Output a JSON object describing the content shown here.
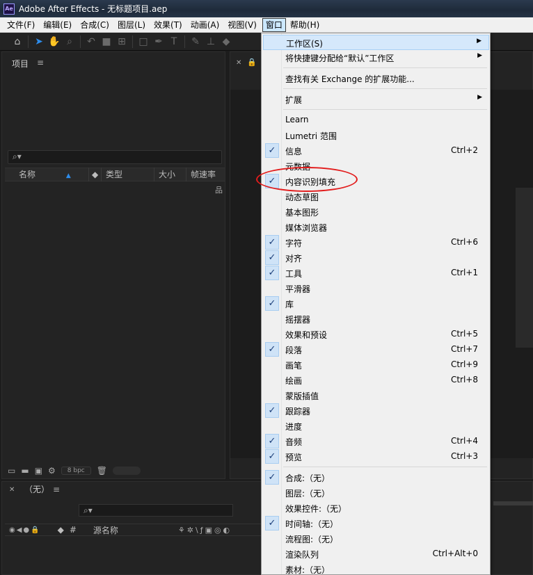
{
  "window": {
    "logo_text": "Ae",
    "title": "Adobe After Effects - 无标题项目.aep"
  },
  "menubar": [
    {
      "label": "文件(F)",
      "active": false
    },
    {
      "label": "编辑(E)",
      "active": false
    },
    {
      "label": "合成(C)",
      "active": false
    },
    {
      "label": "图层(L)",
      "active": false
    },
    {
      "label": "效果(T)",
      "active": false
    },
    {
      "label": "动画(A)",
      "active": false
    },
    {
      "label": "视图(V)",
      "active": false
    },
    {
      "label": "窗口",
      "active": true
    },
    {
      "label": "帮助(H)",
      "active": false
    }
  ],
  "project_panel": {
    "title": "项目",
    "menu_glyph": "≡",
    "search_glyph": "⌕▾",
    "columns": {
      "name": "名称",
      "type": "类型",
      "size": "大小",
      "rate": "帧速率"
    },
    "bpc": "8 bpc"
  },
  "timeline_panel": {
    "title": "（无）",
    "menu_glyph": "≡",
    "column_name": "源名称",
    "column_hash": "#"
  },
  "window_menu": {
    "items": [
      {
        "label": "工作区(S)",
        "submenu": true,
        "checked": false,
        "shortcut": "",
        "highlight": true
      },
      {
        "label": "将快捷键分配给“默认”工作区",
        "submenu": true,
        "checked": false,
        "shortcut": ""
      },
      {
        "separator": true
      },
      {
        "label": "查找有关 Exchange 的扩展功能...",
        "checked": false,
        "shortcut": ""
      },
      {
        "separator": true
      },
      {
        "label": "扩展",
        "submenu": true,
        "checked": false,
        "shortcut": ""
      },
      {
        "separator": true
      },
      {
        "label": "Learn",
        "checked": false,
        "shortcut": ""
      },
      {
        "label": "Lumetri 范围",
        "checked": false,
        "shortcut": ""
      },
      {
        "label": "信息",
        "checked": true,
        "shortcut": "Ctrl+2"
      },
      {
        "label": "元数据",
        "checked": false,
        "shortcut": ""
      },
      {
        "label": "内容识别填充",
        "checked": true,
        "shortcut": ""
      },
      {
        "label": "动态草图",
        "checked": false,
        "shortcut": ""
      },
      {
        "label": "基本图形",
        "checked": false,
        "shortcut": ""
      },
      {
        "label": "媒体浏览器",
        "checked": false,
        "shortcut": ""
      },
      {
        "label": "字符",
        "checked": true,
        "shortcut": "Ctrl+6"
      },
      {
        "label": "对齐",
        "checked": true,
        "shortcut": ""
      },
      {
        "label": "工具",
        "checked": true,
        "shortcut": "Ctrl+1"
      },
      {
        "label": "平滑器",
        "checked": false,
        "shortcut": ""
      },
      {
        "label": "库",
        "checked": true,
        "shortcut": ""
      },
      {
        "label": "摇摆器",
        "checked": false,
        "shortcut": ""
      },
      {
        "label": "效果和预设",
        "checked": false,
        "shortcut": "Ctrl+5"
      },
      {
        "label": "段落",
        "checked": true,
        "shortcut": "Ctrl+7"
      },
      {
        "label": "画笔",
        "checked": false,
        "shortcut": "Ctrl+9"
      },
      {
        "label": "绘画",
        "checked": false,
        "shortcut": "Ctrl+8"
      },
      {
        "label": "蒙版插值",
        "checked": false,
        "shortcut": ""
      },
      {
        "label": "跟踪器",
        "checked": true,
        "shortcut": ""
      },
      {
        "label": "进度",
        "checked": false,
        "shortcut": ""
      },
      {
        "label": "音频",
        "checked": true,
        "shortcut": "Ctrl+4"
      },
      {
        "label": "预览",
        "checked": true,
        "shortcut": "Ctrl+3"
      },
      {
        "separator": true
      },
      {
        "label": "合成:（无）",
        "checked": true,
        "shortcut": ""
      },
      {
        "label": "图层:（无）",
        "checked": false,
        "shortcut": ""
      },
      {
        "label": "效果控件:（无）",
        "checked": false,
        "shortcut": ""
      },
      {
        "label": "时间轴:（无）",
        "checked": true,
        "shortcut": ""
      },
      {
        "label": "流程图:（无）",
        "checked": false,
        "shortcut": ""
      },
      {
        "label": "渲染队列",
        "checked": false,
        "shortcut": "Ctrl+Alt+0"
      },
      {
        "label": "素材:（无）",
        "checked": false,
        "shortcut": ""
      }
    ]
  }
}
